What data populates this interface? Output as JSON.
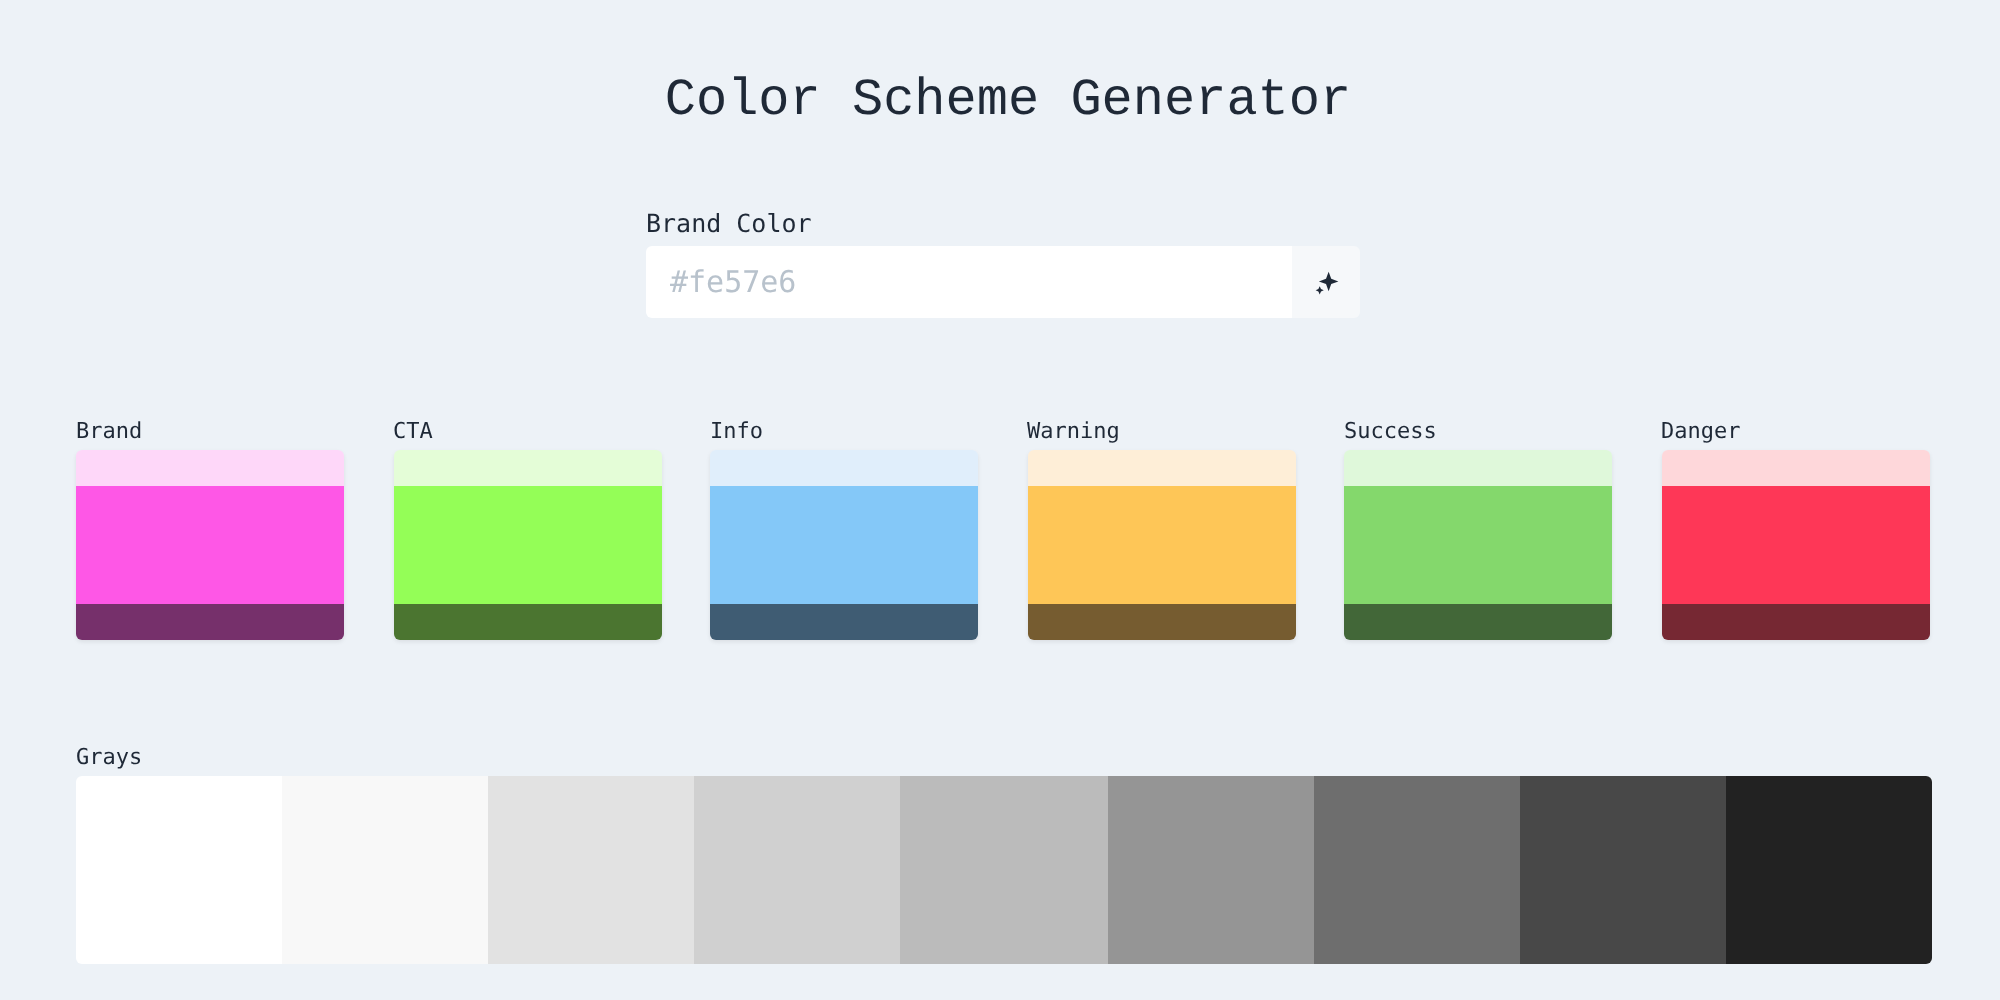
{
  "title": "Color Scheme Generator",
  "brand_field": {
    "label": "Brand Color",
    "placeholder": "#fe57e6"
  },
  "palettes": [
    {
      "name": "Brand",
      "swatches": [
        {
          "color": "#fed7f9"
        },
        {
          "color": "#fe57e6"
        },
        {
          "color": "#76306b"
        }
      ]
    },
    {
      "name": "CTA",
      "swatches": [
        {
          "color": "#e4fdd7"
        },
        {
          "color": "#94fe57"
        },
        {
          "color": "#4b7530"
        }
      ]
    },
    {
      "name": "Info",
      "swatches": [
        {
          "color": "#e0eefb"
        },
        {
          "color": "#84c8f8"
        },
        {
          "color": "#3f5c73"
        }
      ]
    },
    {
      "name": "Warning",
      "swatches": [
        {
          "color": "#feeed7"
        },
        {
          "color": "#fec657"
        },
        {
          "color": "#765c30"
        }
      ]
    },
    {
      "name": "Success",
      "swatches": [
        {
          "color": "#dff8da"
        },
        {
          "color": "#84d86c"
        },
        {
          "color": "#426738"
        }
      ]
    },
    {
      "name": "Danger",
      "swatches": [
        {
          "color": "#fed7da"
        },
        {
          "color": "#fe3757"
        },
        {
          "color": "#762833"
        }
      ]
    }
  ],
  "grays": {
    "label": "Grays",
    "swatches": [
      {
        "color": "#ffffff"
      },
      {
        "color": "#f8f8f8"
      },
      {
        "color": "#e2e2e2"
      },
      {
        "color": "#d0d0d0"
      },
      {
        "color": "#bbbbbb"
      },
      {
        "color": "#959595"
      },
      {
        "color": "#6e6e6e"
      },
      {
        "color": "#484848"
      },
      {
        "color": "#222222"
      }
    ]
  }
}
